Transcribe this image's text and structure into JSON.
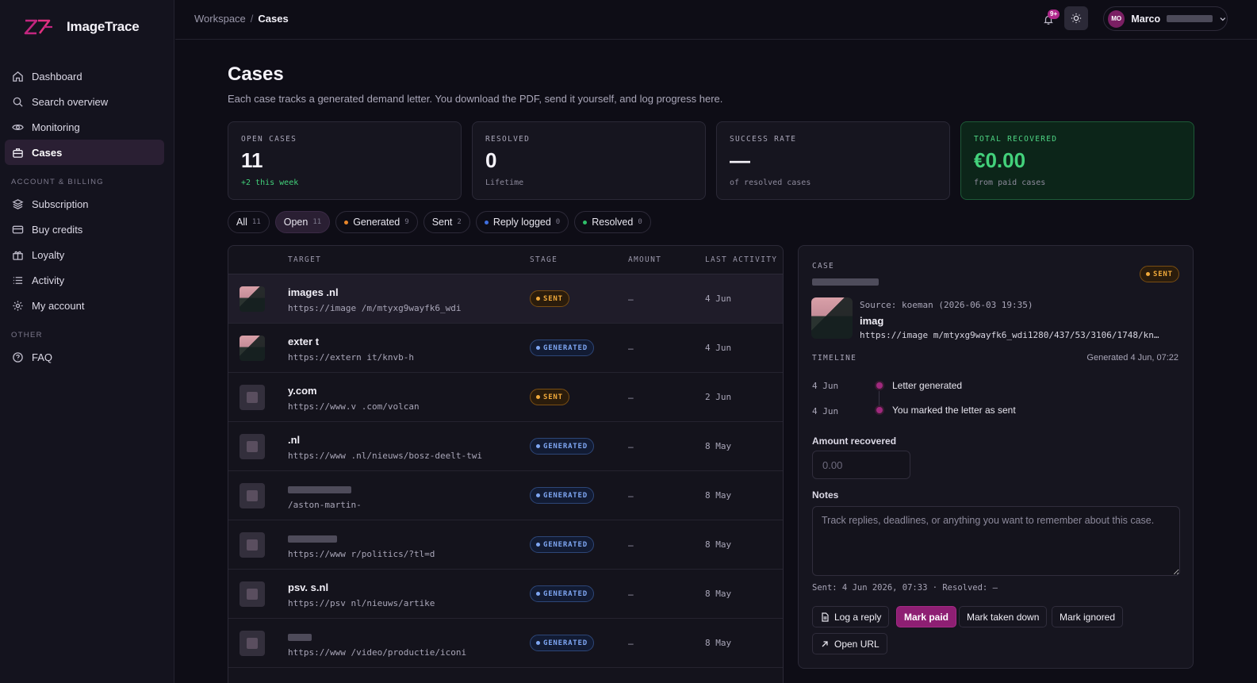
{
  "app": {
    "name": "ImageTrace"
  },
  "sidebar": {
    "items": [
      {
        "label": "Dashboard",
        "icon": "home-icon"
      },
      {
        "label": "Search overview",
        "icon": "search-icon"
      },
      {
        "label": "Monitoring",
        "icon": "eye-icon"
      },
      {
        "label": "Cases",
        "icon": "briefcase-icon"
      }
    ],
    "account_section": "ACCOUNT & BILLING",
    "account_items": [
      {
        "label": "Subscription",
        "icon": "layers-icon"
      },
      {
        "label": "Buy credits",
        "icon": "credit-card-icon"
      },
      {
        "label": "Loyalty",
        "icon": "gift-icon"
      },
      {
        "label": "Activity",
        "icon": "list-icon"
      },
      {
        "label": "My account",
        "icon": "gear-icon"
      }
    ],
    "other_section": "OTHER",
    "other_items": [
      {
        "label": "FAQ",
        "icon": "help-circle-icon"
      }
    ]
  },
  "topbar": {
    "breadcrumb_root": "Workspace",
    "breadcrumb_sep": "/",
    "breadcrumb_current": "Cases",
    "notification_count": "9+",
    "user_initials": "MO",
    "user_name": "Marco"
  },
  "page": {
    "title": "Cases",
    "description": "Each case tracks a generated demand letter. You download the PDF, send it yourself, and log progress here."
  },
  "stats": [
    {
      "label": "OPEN CASES",
      "value": "11",
      "sub": "+2 this week"
    },
    {
      "label": "RESOLVED",
      "value": "0",
      "sub": "Lifetime"
    },
    {
      "label": "SUCCESS RATE",
      "value": "—",
      "sub": "of resolved cases"
    },
    {
      "label": "TOTAL RECOVERED",
      "value": "€0.00",
      "sub": "from paid cases"
    }
  ],
  "filters": [
    {
      "label": "All",
      "count": "11",
      "dot": ""
    },
    {
      "label": "Open",
      "count": "11",
      "dot": ""
    },
    {
      "label": "Generated",
      "count": "9",
      "dot": "#e8862a"
    },
    {
      "label": "Sent",
      "count": "2",
      "dot": ""
    },
    {
      "label": "Reply logged",
      "count": "0",
      "dot": "#3f6fe0"
    },
    {
      "label": "Resolved",
      "count": "0",
      "dot": "#2fbf6a"
    }
  ],
  "table": {
    "headers": {
      "target": "TARGET",
      "stage": "STAGE",
      "amount": "AMOUNT",
      "last_activity": "LAST ACTIVITY"
    },
    "rows": [
      {
        "title": "images .nl",
        "url": "https://image /m/mtyxg9wayfk6_wdi",
        "stage": "SENT",
        "amount": "–",
        "date": "4 Jun",
        "thumb": "img"
      },
      {
        "title": "exter t",
        "url": "https://extern it/knvb-h",
        "stage": "GENERATED",
        "amount": "–",
        "date": "4 Jun",
        "thumb": "img"
      },
      {
        "title": "y.com",
        "url": "https://www.v .com/volcan",
        "stage": "SENT",
        "amount": "–",
        "date": "2 Jun",
        "thumb": "placeholder"
      },
      {
        "title": ".nl",
        "url": "https://www .nl/nieuws/bosz-deelt-twi",
        "stage": "GENERATED",
        "amount": "–",
        "date": "8 May",
        "thumb": "placeholder"
      },
      {
        "title": "",
        "url": "/aston-martin-",
        "stage": "GENERATED",
        "amount": "–",
        "date": "8 May",
        "thumb": "placeholder"
      },
      {
        "title": "",
        "url": "https://www r/politics/?tl=d",
        "stage": "GENERATED",
        "amount": "–",
        "date": "8 May",
        "thumb": "placeholder"
      },
      {
        "title": "psv. s.nl",
        "url": "https://psv nl/nieuws/artike",
        "stage": "GENERATED",
        "amount": "–",
        "date": "8 May",
        "thumb": "placeholder"
      },
      {
        "title": "",
        "url": "https://www /video/productie/iconi",
        "stage": "GENERATED",
        "amount": "–",
        "date": "8 May",
        "thumb": "placeholder"
      }
    ]
  },
  "panel": {
    "case_label": "CASE",
    "stage": "SENT",
    "source": "Source: koeman (2026-06-03 19:35)",
    "title": "imag",
    "url": "https://image m/mtyxg9wayfk6_wdi1280/437/53/3106/1748/kn…",
    "timeline_label": "TIMELINE",
    "generated": "Generated 4 Jun, 07:22",
    "timeline": [
      {
        "date": "4 Jun",
        "text": "Letter generated"
      },
      {
        "date": "4 Jun",
        "text": "You marked the letter as sent"
      }
    ],
    "amount_label": "Amount recovered",
    "amount_placeholder": "0.00",
    "notes_label": "Notes",
    "notes_placeholder": "Track replies, deadlines, or anything you want to remember about this case.",
    "meta": "Sent: 4 Jun 2026, 07:33 · Resolved: —",
    "buttons": {
      "log_reply": "Log a reply",
      "mark_paid": "Mark paid",
      "mark_taken_down": "Mark taken down",
      "mark_ignored": "Mark ignored",
      "open_url": "Open URL"
    }
  }
}
